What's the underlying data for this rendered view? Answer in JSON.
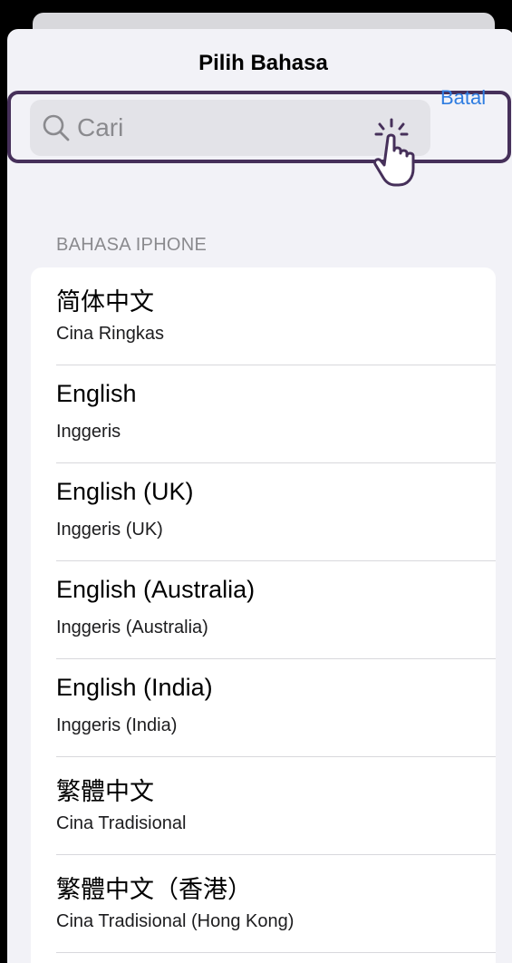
{
  "sheet": {
    "title": "Pilih Bahasa"
  },
  "search": {
    "placeholder": "Cari",
    "cancel_label": "Batal"
  },
  "section": {
    "header": "BAHASA IPHONE"
  },
  "languages": [
    {
      "native": "简体中文",
      "translated": "Cina Ringkas"
    },
    {
      "native": "English",
      "translated": "Inggeris"
    },
    {
      "native": "English (UK)",
      "translated": "Inggeris (UK)"
    },
    {
      "native": "English (Australia)",
      "translated": "Inggeris (Australia)"
    },
    {
      "native": "English (India)",
      "translated": "Inggeris (India)"
    },
    {
      "native": "繁體中文",
      "translated": "Cina Tradisional"
    },
    {
      "native": "繁體中文（香港）",
      "translated": "Cina Tradisional (Hong Kong)"
    }
  ],
  "colors": {
    "accent": "#2f7de1",
    "highlight": "#46305a"
  }
}
